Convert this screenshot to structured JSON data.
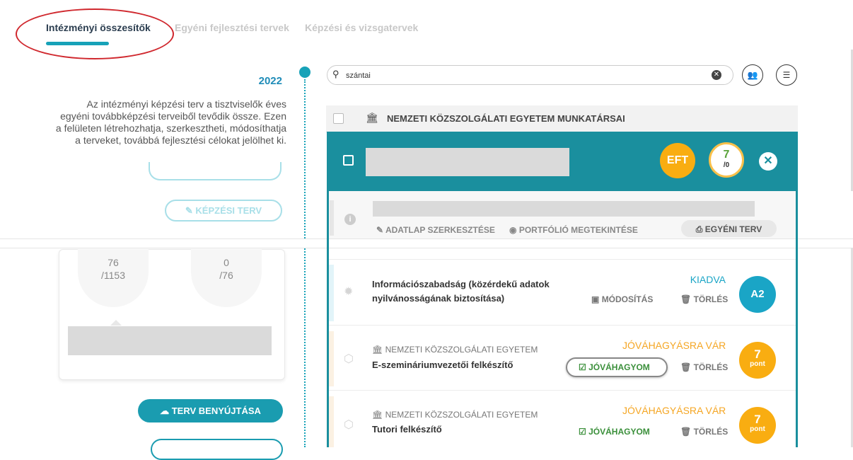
{
  "tabs": [
    {
      "label": "Intézményi összesítők",
      "active": true
    },
    {
      "label": "Egyéni fejlesztési tervek",
      "active": false
    },
    {
      "label": "Képzési és vizsgatervek",
      "active": false
    }
  ],
  "left": {
    "year": "2022",
    "description": "Az intézményi képzési terv a tisztviselők éves egyéni továbbképzési terveiből tevődik össze. Ezen a felületen létrehozhatja, szerkesztheti, módosíthatja a terveket, továbbá fejlesztési célokat jelölhet ki.",
    "kepzesi_terv_label": "✎ KÉPZÉSI TERV",
    "stats": [
      {
        "top": "76",
        "bottom": "/1153"
      },
      {
        "top": "0",
        "bottom": "/76"
      }
    ],
    "submit_label": "TERV BENYÚJTÁSA"
  },
  "search": {
    "value": "szántai"
  },
  "org": {
    "title": "NEMZETI KÖZSZOLGÁLATI EGYETEM MUNKATÁRSAI"
  },
  "person": {
    "eft_badge": "EFT",
    "points_value": "7",
    "points_total": "/0"
  },
  "info": {
    "edit_label": "ADATLAP SZERKESZTÉSE",
    "portfolio_label": "PORTFÓLIÓ MEGTEKINTÉSE",
    "egyeni_label": "EGYÉNI TERV"
  },
  "courses": [
    {
      "title": "Információszabadság (közérdekű adatok nyilvánosságának biztosítása)",
      "status": "KIADVA",
      "status_color": "#1aa5c6",
      "modify_label": "MÓDOSÍTÁS",
      "delete_label": "TÖRLÉS",
      "badge": "A2"
    },
    {
      "org": "NEMZETI KÖZSZOLGÁLATI EGYETEM",
      "title": "E-szemináriumvezetői felkészítő",
      "status": "JÓVÁHAGYÁSRA VÁR",
      "status_color": "#f5a623",
      "approve_label": "JÓVÁHAGYOM",
      "delete_label": "TÖRLÉS",
      "badge_value": "7",
      "badge_unit": "pont"
    },
    {
      "org": "NEMZETI KÖZSZOLGÁLATI EGYETEM",
      "title": "Tutori felkészítő",
      "status": "JÓVÁHAGYÁSRA VÁR",
      "status_color": "#f5a623",
      "approve_label": "JÓVÁHAGYOM",
      "delete_label": "TÖRLÉS",
      "badge_value": "7",
      "badge_unit": "pont"
    }
  ],
  "colors": {
    "accent": "#1a8f9e",
    "orange": "#f9ad11",
    "annotation": "#d0282e"
  }
}
